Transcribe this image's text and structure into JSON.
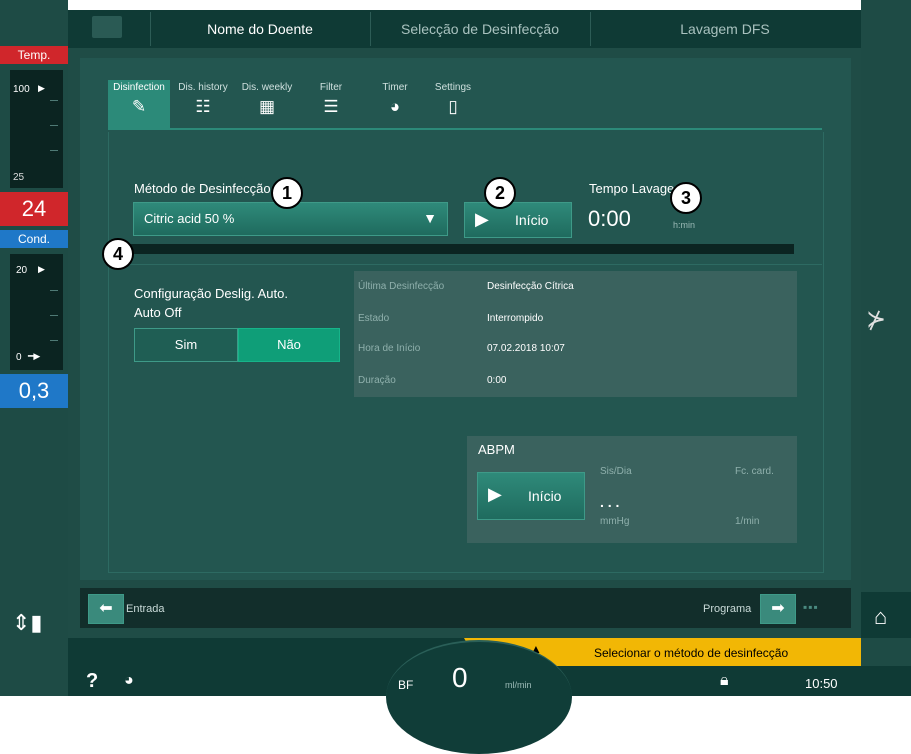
{
  "top_tabs": {
    "patient_name": "Nome do Doente",
    "disinfection_select": "Selecção de Desinfecção",
    "dfs_rinse": "Lavagem DFS"
  },
  "left_panel": {
    "temp_label": "Temp.",
    "temp_max": "100",
    "temp_min": "25",
    "temp_value": "24",
    "cond_label": "Cond.",
    "cond_max": "20",
    "cond_min": "0",
    "cond_value": "0,3"
  },
  "sub_tabs": [
    {
      "label": "Disinfection",
      "icon": "disinfection-icon"
    },
    {
      "label": "Dis. history",
      "icon": "history-icon"
    },
    {
      "label": "Dis. weekly",
      "icon": "weekly-icon"
    },
    {
      "label": "Filter",
      "icon": "filter-icon"
    },
    {
      "label": "Timer",
      "icon": "timer-icon"
    },
    {
      "label": "Settings",
      "icon": "settings-icon"
    }
  ],
  "method": {
    "label": "Método de Desinfecção",
    "value": "Citric acid 50 %"
  },
  "start_button": "Início",
  "rinse_time": {
    "label": "Tempo Lavagem",
    "value": "0:00",
    "unit": "h:min"
  },
  "callouts": [
    "1",
    "2",
    "3",
    "4"
  ],
  "auto_off": {
    "title": "Configuração Deslig. Auto.",
    "subtitle": "Auto Off",
    "yes": "Sim",
    "no": "Não"
  },
  "last_disinfection": {
    "rows": [
      {
        "key": "Última Desinfecção",
        "value": "Desinfecção Cítrica"
      },
      {
        "key": "Estado",
        "value": "Interrompido"
      },
      {
        "key": "Hora de Início",
        "value": "07.02.2018 10:07"
      },
      {
        "key": "Duração",
        "value": "0:00"
      }
    ]
  },
  "abpm": {
    "title": "ABPM",
    "start": "Início",
    "sys_dia": "Sis/Dia",
    "pulse": "Fc. card.",
    "value": ". . .",
    "unit_pressure": "mmHg",
    "unit_pulse": "1/min"
  },
  "nav": {
    "back": "Entrada",
    "next": "Programa"
  },
  "status": {
    "message": "Selecionar o método de desinfecção",
    "bf_label": "BF",
    "bf_value": "0",
    "bf_unit": "ml/min",
    "time": "10:50",
    "help": "?"
  },
  "colors": {
    "accent": "#2c8a79",
    "warning": "#f2b705",
    "temp": "#d0262b",
    "cond": "#1f78c8"
  }
}
